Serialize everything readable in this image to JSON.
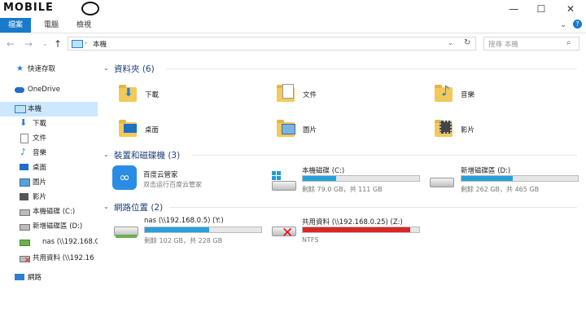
{
  "watermark": "MOBILE",
  "ribbon": {
    "tabs": [
      "檔案",
      "電腦",
      "檢視"
    ]
  },
  "address": {
    "location": "本機",
    "search_placeholder": "搜尋 本機"
  },
  "sidebar": {
    "items": [
      {
        "label": "快速存取",
        "icon": "star-icon"
      },
      {
        "label": "OneDrive",
        "icon": "cloud-icon"
      },
      {
        "label": "本機",
        "icon": "computer-icon"
      },
      {
        "label": "下載",
        "icon": "download-icon"
      },
      {
        "label": "文件",
        "icon": "document-icon"
      },
      {
        "label": "音樂",
        "icon": "music-icon"
      },
      {
        "label": "桌面",
        "icon": "desktop-icon"
      },
      {
        "label": "圖片",
        "icon": "picture-icon"
      },
      {
        "label": "影片",
        "icon": "video-icon"
      },
      {
        "label": "本機磁碟 (C:)",
        "icon": "drive-icon"
      },
      {
        "label": "新增磁碟區 (D:)",
        "icon": "drive-icon"
      },
      {
        "label": "nas (\\\\192.168.0",
        "icon": "network-drive-icon"
      },
      {
        "label": "共用資料 (\\\\192.16",
        "icon": "network-drive-error-icon"
      },
      {
        "label": "網路",
        "icon": "network-icon"
      }
    ]
  },
  "groups": {
    "folders": {
      "header": "資料夾 (6)",
      "items": [
        "下載",
        "文件",
        "音樂",
        "桌面",
        "圖片",
        "影片"
      ]
    },
    "devices": {
      "header": "裝置和磁碟機 (3)",
      "items": [
        {
          "label": "百度云管家",
          "sub": "双击运行百度云管家",
          "icon": "baidu-cloud-icon"
        },
        {
          "label": "本機磁碟 (C:)",
          "sub": "剩餘 79.0 GB，共 111 GB",
          "used": 0.29,
          "color": "#26a0da"
        },
        {
          "label": "新增磁碟區 (D:)",
          "sub": "剩餘 262 GB，共 465 GB",
          "used": 0.44,
          "color": "#26a0da"
        }
      ]
    },
    "network": {
      "header": "網路位置 (2)",
      "items": [
        {
          "label": "nas (\\\\192.168.0.5) (Y:)",
          "sub": "剩餘 102 GB，共 228 GB",
          "used": 0.55,
          "color": "#26a0da"
        },
        {
          "label": "共用資料 (\\\\192.168.0.25) (Z:)",
          "sub": "NTFS",
          "used": 0.92,
          "color": "#da2626"
        }
      ]
    }
  }
}
